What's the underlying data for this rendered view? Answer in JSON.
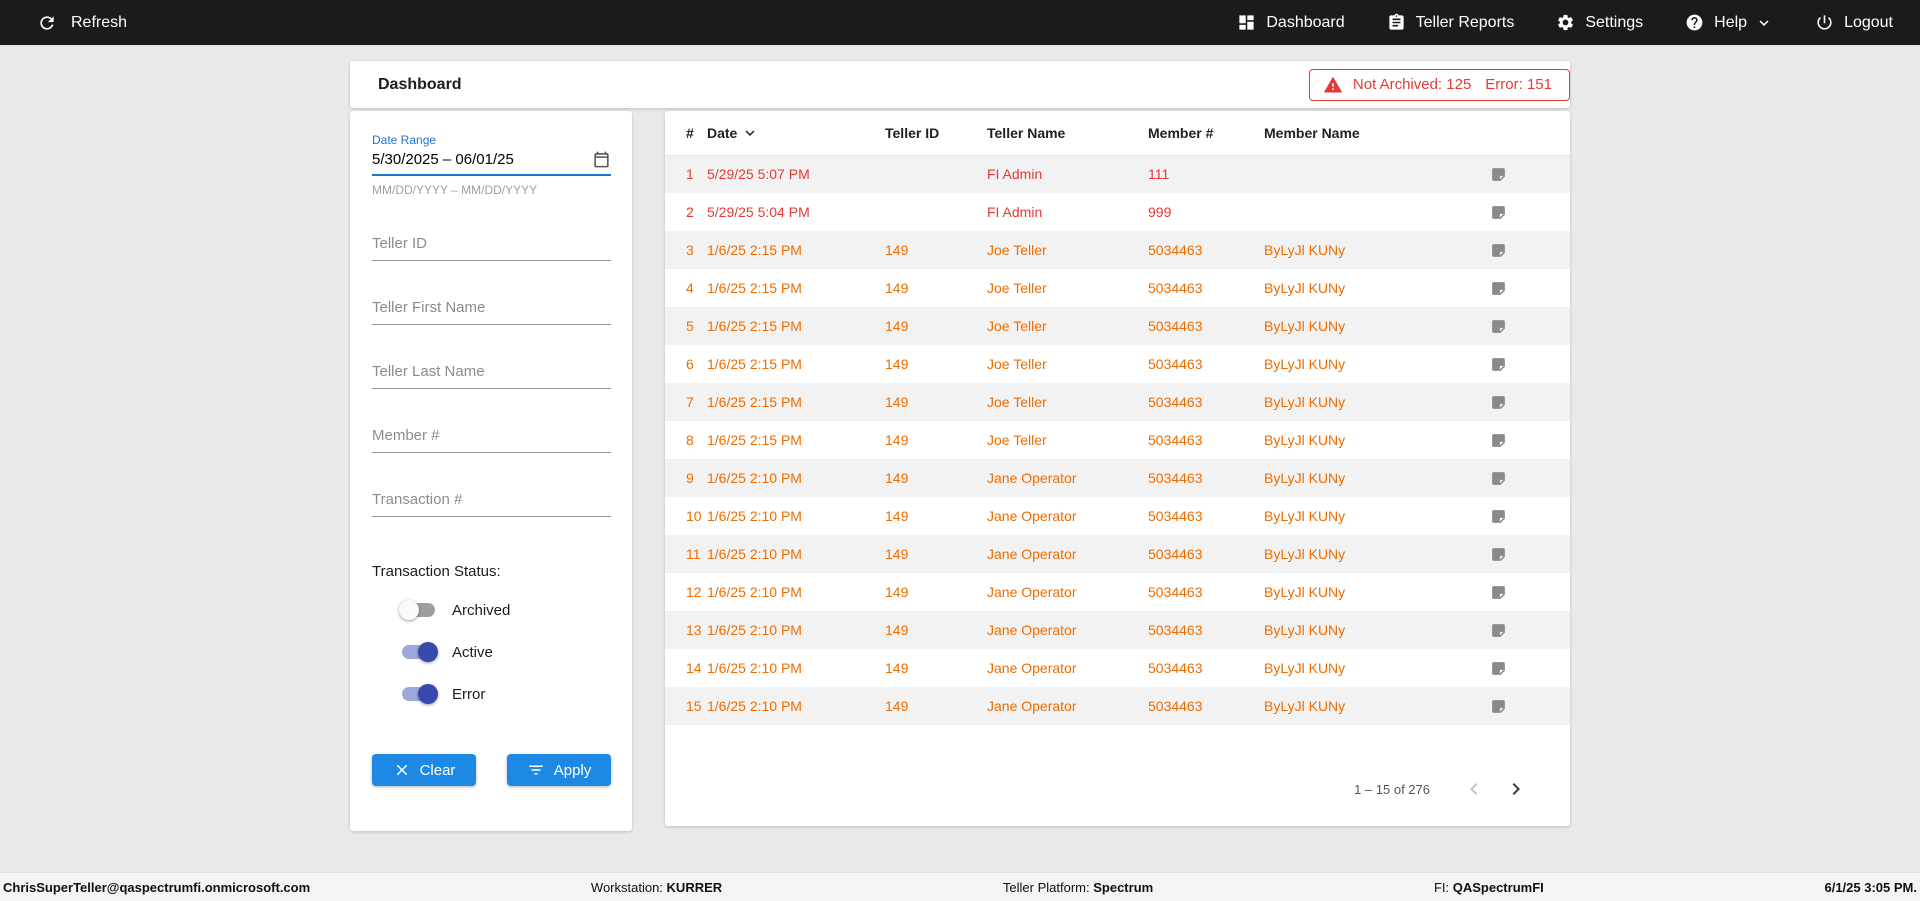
{
  "colors": {
    "accent": "#1e88e5",
    "error": "#e53935",
    "warning": "#ef6c00",
    "toggle_on": "#3949ab",
    "topbar_bg": "#1b1b1b"
  },
  "topbar": {
    "refresh_label": "Refresh",
    "dashboard_label": "Dashboard",
    "teller_reports_label": "Teller Reports",
    "settings_label": "Settings",
    "help_label": "Help",
    "logout_label": "Logout"
  },
  "page": {
    "title": "Dashboard"
  },
  "alert": {
    "not_archived": "Not Archived: 125",
    "error": "Error: 151"
  },
  "filters": {
    "date_range": {
      "label": "Date Range",
      "value": "5/30/2025 – 06/01/25",
      "hint": "MM/DD/YYYY – MM/DD/YYYY"
    },
    "teller_id_placeholder": "Teller ID",
    "teller_first_name_placeholder": "Teller First Name",
    "teller_last_name_placeholder": "Teller Last Name",
    "member_num_placeholder": "Member #",
    "transaction_num_placeholder": "Transaction #",
    "status_label": "Transaction Status:",
    "toggles": [
      {
        "label": "Archived",
        "on": false
      },
      {
        "label": "Active",
        "on": true
      },
      {
        "label": "Error",
        "on": true
      }
    ],
    "clear_label": "Clear",
    "apply_label": "Apply"
  },
  "table": {
    "columns": [
      "#",
      "Date",
      "Teller ID",
      "Teller Name",
      "Member #",
      "Member Name"
    ],
    "rows": [
      {
        "num": "1",
        "date": "5/29/25 5:07 PM",
        "teller_id": "",
        "teller_name": "FI Admin",
        "member_num": "111",
        "member_name": "",
        "status": "error"
      },
      {
        "num": "2",
        "date": "5/29/25 5:04 PM",
        "teller_id": "",
        "teller_name": "FI Admin",
        "member_num": "999",
        "member_name": "",
        "status": "error"
      },
      {
        "num": "3",
        "date": "1/6/25 2:15 PM",
        "teller_id": "149",
        "teller_name": "Joe Teller",
        "member_num": "5034463",
        "member_name": "ByLyJl KUNy",
        "status": "warning"
      },
      {
        "num": "4",
        "date": "1/6/25 2:15 PM",
        "teller_id": "149",
        "teller_name": "Joe Teller",
        "member_num": "5034463",
        "member_name": "ByLyJl KUNy",
        "status": "warning"
      },
      {
        "num": "5",
        "date": "1/6/25 2:15 PM",
        "teller_id": "149",
        "teller_name": "Joe Teller",
        "member_num": "5034463",
        "member_name": "ByLyJl KUNy",
        "status": "warning"
      },
      {
        "num": "6",
        "date": "1/6/25 2:15 PM",
        "teller_id": "149",
        "teller_name": "Joe Teller",
        "member_num": "5034463",
        "member_name": "ByLyJl KUNy",
        "status": "warning"
      },
      {
        "num": "7",
        "date": "1/6/25 2:15 PM",
        "teller_id": "149",
        "teller_name": "Joe Teller",
        "member_num": "5034463",
        "member_name": "ByLyJl KUNy",
        "status": "warning"
      },
      {
        "num": "8",
        "date": "1/6/25 2:15 PM",
        "teller_id": "149",
        "teller_name": "Joe Teller",
        "member_num": "5034463",
        "member_name": "ByLyJl KUNy",
        "status": "warning"
      },
      {
        "num": "9",
        "date": "1/6/25 2:10 PM",
        "teller_id": "149",
        "teller_name": "Jane Operator",
        "member_num": "5034463",
        "member_name": "ByLyJl KUNy",
        "status": "warning"
      },
      {
        "num": "10",
        "date": "1/6/25 2:10 PM",
        "teller_id": "149",
        "teller_name": "Jane Operator",
        "member_num": "5034463",
        "member_name": "ByLyJl KUNy",
        "status": "warning"
      },
      {
        "num": "11",
        "date": "1/6/25 2:10 PM",
        "teller_id": "149",
        "teller_name": "Jane Operator",
        "member_num": "5034463",
        "member_name": "ByLyJl KUNy",
        "status": "warning"
      },
      {
        "num": "12",
        "date": "1/6/25 2:10 PM",
        "teller_id": "149",
        "teller_name": "Jane Operator",
        "member_num": "5034463",
        "member_name": "ByLyJl KUNy",
        "status": "warning"
      },
      {
        "num": "13",
        "date": "1/6/25 2:10 PM",
        "teller_id": "149",
        "teller_name": "Jane Operator",
        "member_num": "5034463",
        "member_name": "ByLyJl KUNy",
        "status": "warning"
      },
      {
        "num": "14",
        "date": "1/6/25 2:10 PM",
        "teller_id": "149",
        "teller_name": "Jane Operator",
        "member_num": "5034463",
        "member_name": "ByLyJl KUNy",
        "status": "warning"
      },
      {
        "num": "15",
        "date": "1/6/25 2:10 PM",
        "teller_id": "149",
        "teller_name": "Jane Operator",
        "member_num": "5034463",
        "member_name": "ByLyJl KUNy",
        "status": "warning"
      }
    ],
    "pagination": {
      "range_label": "1 – 15 of 276"
    }
  },
  "footer": {
    "user": "ChrisSuperTeller@qaspectrumfi.onmicrosoft.com",
    "workstation_label": "Workstation:",
    "workstation": "KURRER",
    "platform_label": "Teller Platform:",
    "platform": "Spectrum",
    "fi_label": "FI:",
    "fi": "QASpectrumFI",
    "datetime": "6/1/25 3:05 PM."
  }
}
